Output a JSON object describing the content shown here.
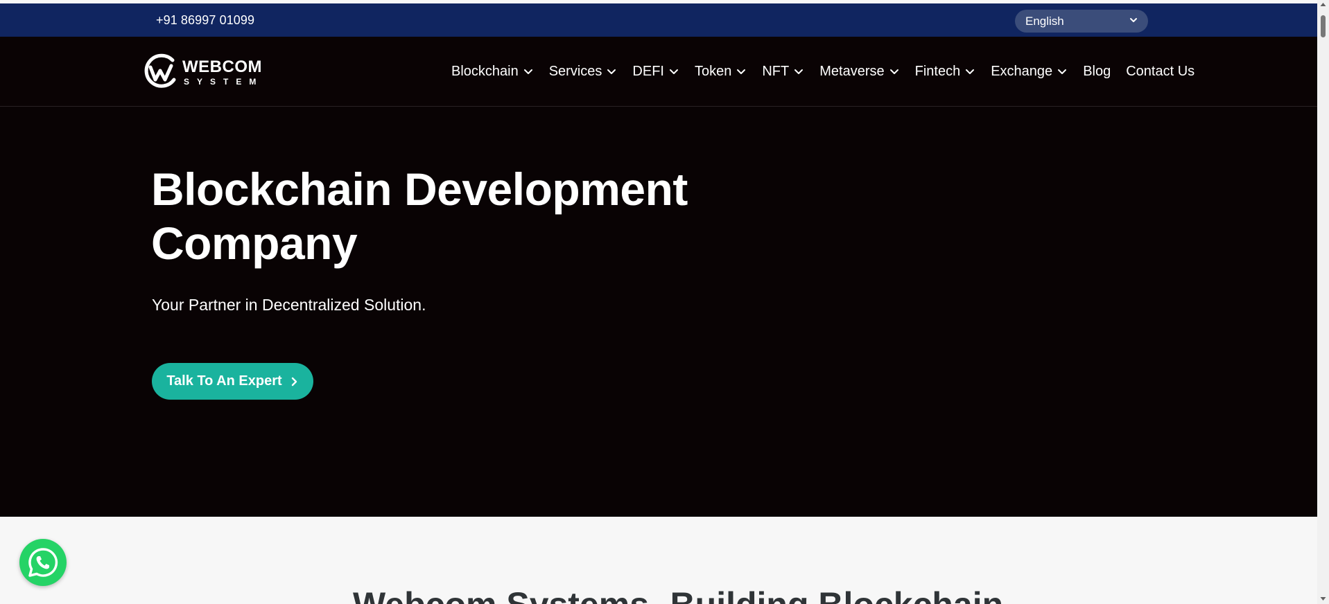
{
  "topbar": {
    "phone": "+91 86997 01099",
    "language": {
      "selected": "English",
      "icon": "chevron-down-icon"
    }
  },
  "logo": {
    "line1": "WEBCOM",
    "line2": "SYSTEM"
  },
  "nav": {
    "items": [
      {
        "label": "Blockchain",
        "dropdown": true
      },
      {
        "label": "Services",
        "dropdown": true
      },
      {
        "label": "DEFI",
        "dropdown": true
      },
      {
        "label": "Token",
        "dropdown": true
      },
      {
        "label": "NFT",
        "dropdown": true
      },
      {
        "label": "Metaverse",
        "dropdown": true
      },
      {
        "label": "Fintech",
        "dropdown": true
      },
      {
        "label": "Exchange",
        "dropdown": true
      },
      {
        "label": "Blog",
        "dropdown": false
      },
      {
        "label": "Contact Us",
        "dropdown": false
      }
    ]
  },
  "hero": {
    "title_line1": "Blockchain Development",
    "title_line2": "Company",
    "subtitle": "Your Partner in Decentralized Solution.",
    "cta_label": "Talk To An Expert"
  },
  "lower": {
    "heading": "Webcom Systems- Building Blockchain"
  },
  "colors": {
    "topbar_bg": "#102560",
    "hero_bg": "#090304",
    "cta_bg": "#1ab39e",
    "whatsapp": "#25d366"
  }
}
